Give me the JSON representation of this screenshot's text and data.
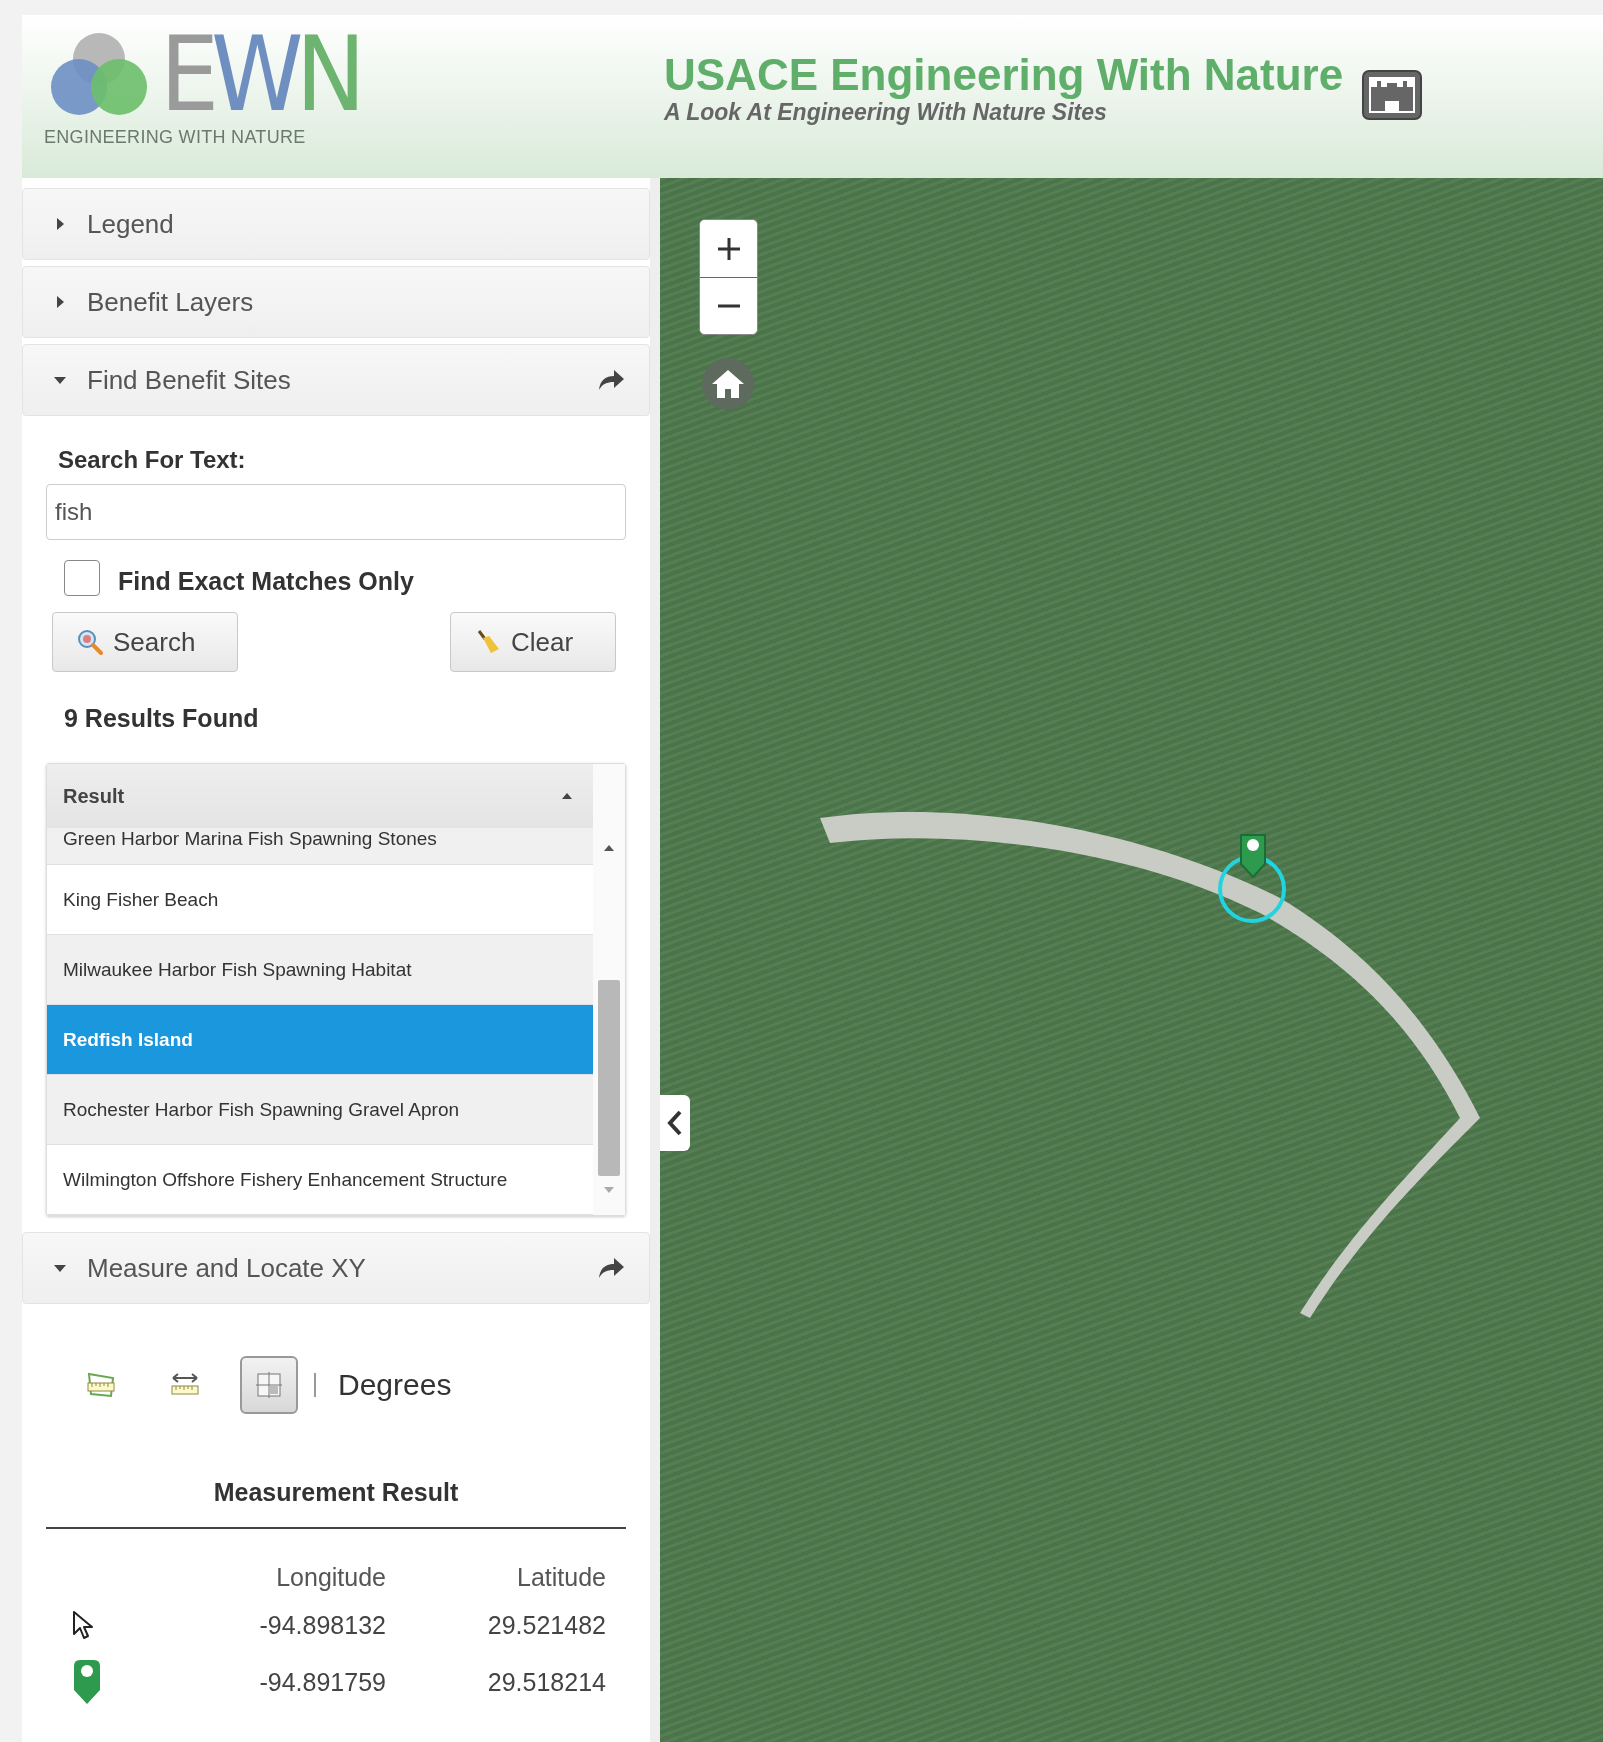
{
  "header": {
    "logo_letters": [
      {
        "text": "E",
        "color": "#9a9a9a"
      },
      {
        "text": "W",
        "color": "#6f8fc0"
      },
      {
        "text": "N",
        "color": "#6cb46f"
      }
    ],
    "logo_caption": "ENGINEERING WITH NATURE",
    "title": "USACE Engineering With Nature",
    "subtitle": "A Look At Engineering With Nature Sites"
  },
  "panels": [
    {
      "title": "Legend",
      "expanded": false,
      "share": false
    },
    {
      "title": "Benefit Layers",
      "expanded": false,
      "share": false
    },
    {
      "title": "Find Benefit Sites",
      "expanded": true,
      "share": true,
      "kind": "search"
    },
    {
      "title": "Measure and Locate XY",
      "expanded": true,
      "share": true,
      "kind": "measure"
    }
  ],
  "search": {
    "label": "Search For Text:",
    "value": "fish",
    "exact_match": {
      "label": "Find Exact Matches Only",
      "checked": false
    },
    "buttons": [
      {
        "label": "Search",
        "kind": "search"
      },
      {
        "label": "Clear",
        "kind": "clear"
      }
    ],
    "results_count": "9 Results Found",
    "grid": {
      "column": "Result",
      "rows": [
        {
          "text": "Green Harbor Marina Fish Spawning Stones",
          "selected": false
        },
        {
          "text": "King Fisher Beach",
          "selected": false
        },
        {
          "text": "Milwaukee Harbor Fish Spawning Habitat",
          "selected": false
        },
        {
          "text": "Redfish Island",
          "selected": true
        },
        {
          "text": "Rochester Harbor Fish Spawning Gravel Apron",
          "selected": false
        },
        {
          "text": "Wilmington Offshore Fishery Enhancement Structure",
          "selected": false
        }
      ]
    }
  },
  "measure": {
    "tools": [
      {
        "kind": "area",
        "selected": false
      },
      {
        "kind": "distance",
        "selected": false
      },
      {
        "kind": "location",
        "selected": true
      }
    ],
    "unit": "Degrees",
    "result_title": "Measurement Result",
    "columns": [
      "Longitude",
      "Latitude"
    ],
    "rows": [
      {
        "kind": "cursor",
        "longitude": "-94.898132",
        "latitude": "29.521482"
      },
      {
        "kind": "pin",
        "longitude": "-94.891759",
        "latitude": "29.518214"
      }
    ]
  }
}
